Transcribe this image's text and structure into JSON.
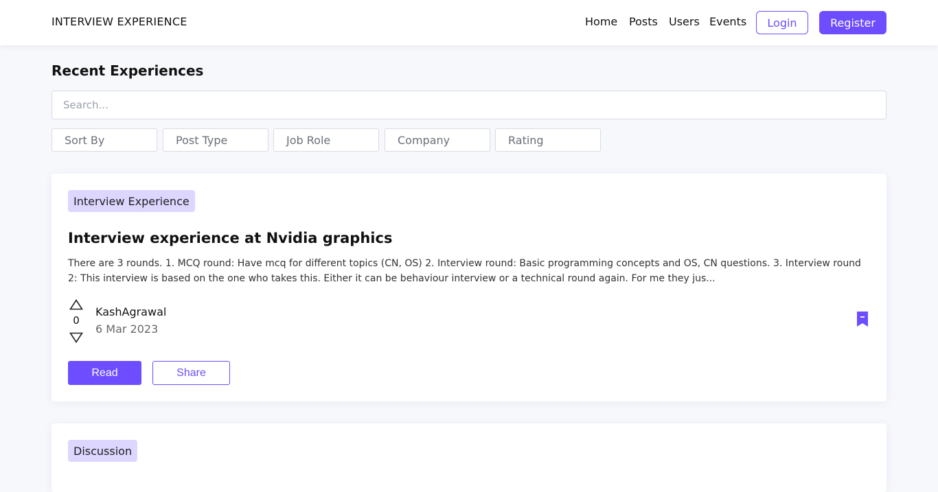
{
  "nav": {
    "brand": "INTERVIEW EXPERIENCE",
    "links": [
      "Home",
      "Posts",
      "Users",
      "Events"
    ],
    "login_label": "Login",
    "register_label": "Register"
  },
  "main": {
    "title": "Recent Experiences",
    "search_placeholder": "Search...",
    "filters": [
      "Sort By",
      "Post Type",
      "Job Role",
      "Company",
      "Rating"
    ]
  },
  "posts": [
    {
      "tag": "Interview Experience",
      "title": "Interview experience at Nvidia graphics",
      "excerpt": "There are 3 rounds. 1. MCQ round: Have mcq for different topics (CN, OS) 2. Interview round: Basic programming concepts and OS, CN questions. 3. Interview round 2: This interview is based on the one who takes this. Either it can be behaviour interview or a technical round again. For me they jus...",
      "votes": "0",
      "author": "KashAgrawal",
      "date": "6 Mar 2023",
      "read_label": "Read",
      "share_label": "Share"
    },
    {
      "tag": "Discussion"
    }
  ],
  "colors": {
    "accent": "#6d4dff",
    "tag_bg": "#ddd6ff",
    "page_bg": "#f7f8fc"
  },
  "icons": {
    "upvote": "triangle-up-icon",
    "downvote": "triangle-down-icon",
    "bookmark": "bookmark-icon"
  }
}
